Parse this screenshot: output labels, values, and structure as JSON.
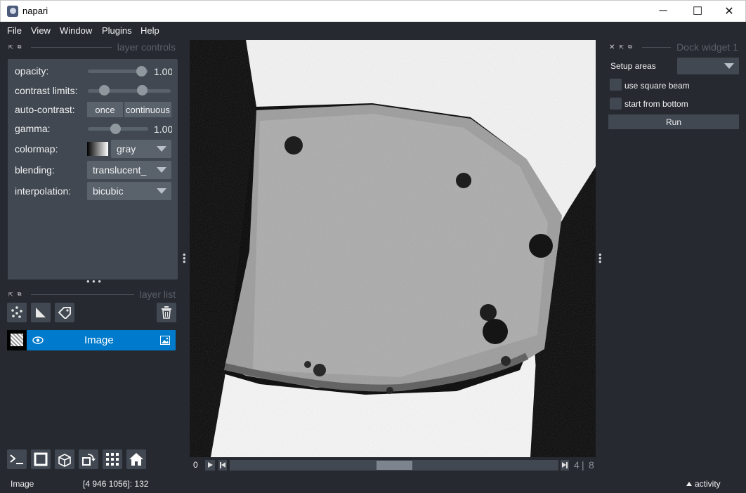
{
  "window": {
    "title": "napari",
    "minimize": "─",
    "maximize": "☐",
    "close": "✕"
  },
  "menu": [
    "File",
    "View",
    "Window",
    "Plugins",
    "Help"
  ],
  "layer_controls": {
    "title": "layer controls",
    "opacity_label": "opacity:",
    "opacity_value": "1.00",
    "contrast_label": "contrast limits:",
    "auto_contrast_label": "auto-contrast:",
    "once_label": "once",
    "continuous_label": "continuous",
    "gamma_label": "gamma:",
    "gamma_value": "1.00",
    "colormap_label": "colormap:",
    "colormap_value": "gray",
    "blending_label": "blending:",
    "blending_value": "translucent_",
    "interpolation_label": "interpolation:",
    "interpolation_value": "bicubic"
  },
  "layer_list": {
    "title": "layer list",
    "layers": [
      {
        "name": "Image",
        "visible": true
      }
    ]
  },
  "dock_widget": {
    "title": "Dock widget 1",
    "setup_areas_label": "Setup areas",
    "setup_areas_value": "",
    "square_beam_label": "use square beam",
    "square_beam_checked": false,
    "start_bottom_label": "start from bottom",
    "start_bottom_checked": false,
    "run_label": "Run"
  },
  "dims": {
    "play_label": "0",
    "current": "4",
    "separator": "|",
    "total": "8"
  },
  "status": {
    "layer_name": "Image",
    "coords": "[4 946 1056]: 132",
    "activity": "activity",
    "activity_icon": "caret-up-icon"
  },
  "colors": {
    "background": "#262930",
    "panel": "#414851",
    "accent": "#007acc",
    "widget": "#5a626c"
  }
}
